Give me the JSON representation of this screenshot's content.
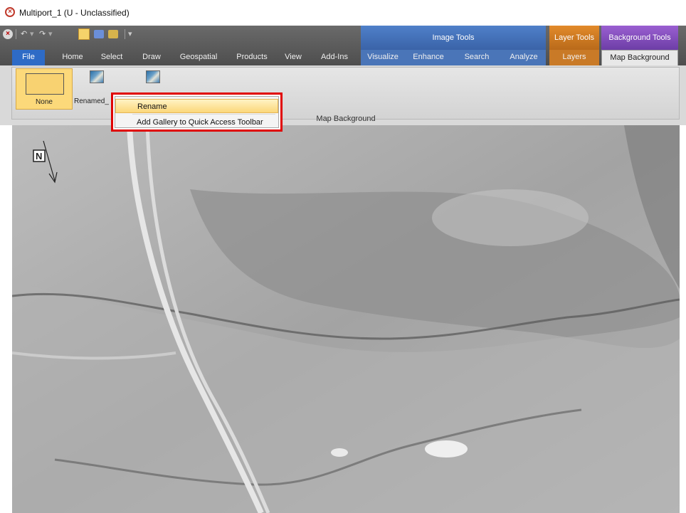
{
  "window": {
    "title": "Multiport_1 (U - Unclassified)",
    "close_icon": "close-red-circle-icon"
  },
  "qat": {
    "icons": [
      "app-close-icon",
      "undo-icon",
      "redo-icon",
      "select-icon",
      "layers-icon",
      "paint-icon",
      "qat-dropdown-icon"
    ]
  },
  "context_groups": {
    "image_tools": "Image Tools",
    "layer_tools": "Layer Tools",
    "background_tools": "Background Tools"
  },
  "tabs": {
    "file": "File",
    "home": "Home",
    "select": "Select",
    "draw": "Draw",
    "geospatial": "Geospatial",
    "products": "Products",
    "view": "View",
    "addins": "Add-Ins",
    "visualize": "Visualize",
    "enhance": "Enhance",
    "search": "Search",
    "analyze": "Analyze",
    "layers": "Layers",
    "map_background": "Map Background"
  },
  "ribbon": {
    "gallery": {
      "none_label": "None",
      "renamed_label": "Renamed_"
    },
    "group_label": "Map Background"
  },
  "context_menu": {
    "rename": "Rename",
    "add_gallery": "Add Gallery to Quick Access Toolbar"
  },
  "map": {
    "north_label": "N"
  },
  "colors": {
    "highlight_border": "#e00000",
    "file_tab": "#2e6bc6",
    "image_tools": "#4f80c9",
    "layer_tools": "#e28a2a",
    "background_tools": "#9a5fd1"
  }
}
